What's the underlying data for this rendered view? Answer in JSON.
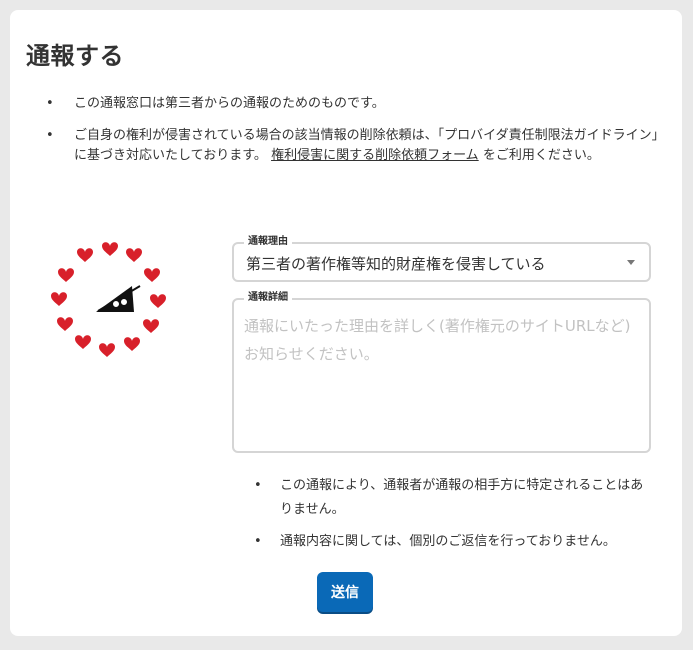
{
  "page": {
    "title": "通報する"
  },
  "notes": [
    {
      "text": "この通報窓口は第三者からの通報のためのものです。"
    },
    {
      "text_before": "ご自身の権利が侵害されている場合の該当情報の削除依頼は、「プロバイダ責任制限法ガイドライン」に基づき対応いたしております。",
      "link_label": "権利侵害に関する削除依頼フォーム",
      "text_after": "をご利用ください。"
    }
  ],
  "form": {
    "reason": {
      "label": "通報理由",
      "selected": "第三者の著作権等知的財産権を侵害している"
    },
    "details": {
      "label": "通報詳細",
      "placeholder": "通報にいたった理由を詳しく(著作権元のサイトURLなど)お知らせください。"
    }
  },
  "footnotes": [
    "この通報により、通報者が通報の相手方に特定されることはありません。",
    "通報内容に関しては、個別のご返信を行っておりません。"
  ],
  "submit_label": "送信",
  "bullet": "•",
  "colors": {
    "heart": "#d8202a",
    "submit": "#0a69b7",
    "background": "#e9e9e9"
  },
  "icons": {
    "illustration": "hearts-ring-tent-icon"
  }
}
